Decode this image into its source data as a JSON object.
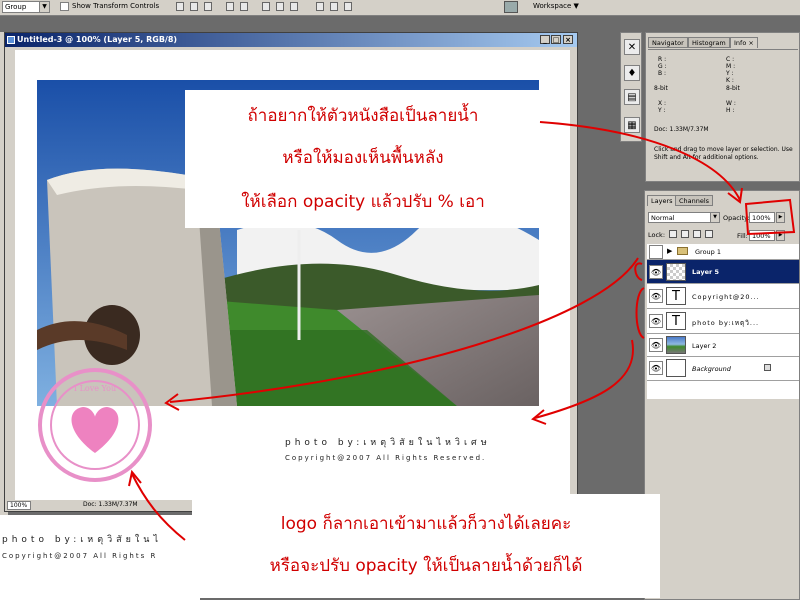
{
  "options_bar": {
    "auto_select_value": "Group",
    "show_transform_label": "Show Transform Controls",
    "workspace_label": "Workspace"
  },
  "document": {
    "title": "Untitled-3 @ 100% (Layer 5, RGB/8)",
    "status_zoom": "100%",
    "status_doc": "Doc: 1.33M/7.37M",
    "caption_photo": "photo by:เหตุวิสัยในไหวิเศษ",
    "caption_copyright": "Copyright@2007 All Rights Reserved.",
    "stamp_text": "I Love You"
  },
  "below_canvas": {
    "line1": "photo by:เหตุวิสัยในไ",
    "line2": "Copyright@2007 All Rights R"
  },
  "info_panel": {
    "tabs": [
      "Navigator",
      "Histogram",
      "Info"
    ],
    "active_tab": "Info",
    "r": "R :",
    "g": "G :",
    "b": "B :",
    "c": "C :",
    "m": "M :",
    "y": "Y :",
    "k": "K :",
    "bit_left": "8-bit",
    "bit_right": "8-bit",
    "x": "X :",
    "y2": "Y :",
    "w": "W :",
    "h": "H :",
    "doc": "Doc: 1.33M/7.37M",
    "hint": "Click and drag to move layer or selection. Use Shift and Alt for additional options."
  },
  "layers_panel": {
    "tabs": [
      "Layers",
      "Channels"
    ],
    "active_tab": "Layers",
    "blend_mode": "Normal",
    "opacity_label": "Opacity:",
    "opacity_value": "100%",
    "lock_label": "Lock:",
    "fill_label": "Fill:",
    "fill_value": "100%",
    "layers": [
      {
        "name": "Group 1",
        "type": "group",
        "visible": false
      },
      {
        "name": "Layer 5",
        "type": "pixel",
        "visible": true,
        "selected": true
      },
      {
        "name": "Copyright@20...",
        "type": "text",
        "visible": true
      },
      {
        "name": "photo by:เหตุวิ...",
        "type": "text",
        "visible": true
      },
      {
        "name": "Layer 2",
        "type": "pixel",
        "visible": true
      },
      {
        "name": "Background",
        "type": "background",
        "visible": true,
        "locked": true
      }
    ]
  },
  "annotations": {
    "top_note": [
      "ถ้าอยากให้ตัวหนังสือเป็นลายน้ำ",
      "หรือให้มองเห็นพื้นหลัง",
      "ให้เลือก opacity แล้วปรับ % เอา"
    ],
    "bottom_note": [
      "logo ก็ลากเอาเข้ามาแล้วก็วางได้เลยคะ",
      "หรือจะปรับ opacity ให้เป็นลายน้ำด้วยก็ได้"
    ]
  },
  "colors": {
    "annotation_red": "#e00000",
    "title_bar": "#0a246a",
    "selected_layer": "#0a246a",
    "stamp_pink": "#e890c8"
  }
}
